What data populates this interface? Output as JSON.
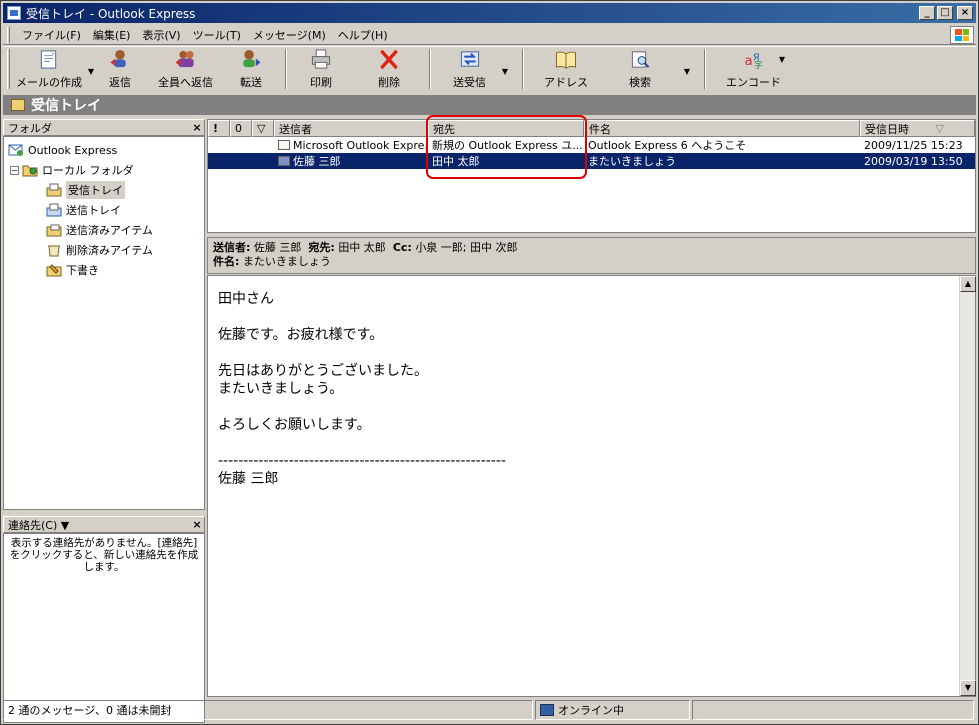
{
  "window": {
    "title": "受信トレイ - Outlook Express",
    "minimize": "_",
    "maximize": "□",
    "close": "×"
  },
  "menu": [
    "ファイル(F)",
    "編集(E)",
    "表示(V)",
    "ツール(T)",
    "メッセージ(M)",
    "ヘルプ(H)"
  ],
  "toolbar": {
    "compose": "メールの作成",
    "reply": "返信",
    "reply_all": "全員へ返信",
    "forward": "転送",
    "print": "印刷",
    "delete": "削除",
    "send_receive": "送受信",
    "addresses": "アドレス",
    "find": "検索",
    "encoding": "エンコード"
  },
  "folder_bar": {
    "title": "受信トレイ"
  },
  "folders_pane": {
    "header": "フォルダ",
    "close": "×",
    "items": [
      {
        "label": "Outlook Express",
        "icon": "outlook-express-icon"
      },
      {
        "label": "ローカル フォルダ",
        "icon": "local-folders-icon",
        "expander": "−"
      },
      {
        "label": "受信トレイ",
        "icon": "inbox-icon"
      },
      {
        "label": "送信トレイ",
        "icon": "outbox-icon"
      },
      {
        "label": "送信済みアイテム",
        "icon": "sent-items-icon"
      },
      {
        "label": "削除済みアイテム",
        "icon": "deleted-items-icon"
      },
      {
        "label": "下書き",
        "icon": "drafts-icon"
      }
    ]
  },
  "contacts_pane": {
    "header": "連絡先(C) ▼",
    "close": "×",
    "message": "表示する連絡先がありません。[連絡先]をクリックすると、新しい連絡先を作成します。"
  },
  "message_list": {
    "columns": {
      "priority": "!",
      "attachment": "0",
      "flag": "▽",
      "from": "送信者",
      "to": "宛先",
      "subject": "件名",
      "received": "受信日時"
    },
    "sort_indicator": "▽",
    "rows": [
      {
        "from": "Microsoft Outlook Expre...",
        "to": "新規の Outlook Express ユ...",
        "subject": "Outlook Express 6 へようこそ",
        "received": "2009/11/25 15:23",
        "selected": false
      },
      {
        "from": "佐藤 三郎",
        "to": "田中 太郎",
        "subject": "またいきましょう",
        "received": "2009/03/19 13:50",
        "selected": true
      }
    ]
  },
  "preview": {
    "from_label": "送信者:",
    "from": "佐藤 三郎",
    "to_label": "宛先:",
    "to": "田中 太郎",
    "cc_label": "Cc:",
    "cc": "小泉 一郎; 田中 次郎",
    "subject_label": "件名:",
    "subject": "またいきましょう",
    "body": [
      "田中さん",
      "佐藤です。お疲れ様です。",
      "先日はありがとうございました。\nまたいきましょう。",
      "よろしくお願いします。",
      "---------------------------------------------------------\n佐藤 三郎"
    ]
  },
  "status": {
    "messages": "2 通のメッセージ、0 通は未開封",
    "online": "オンライン中"
  }
}
